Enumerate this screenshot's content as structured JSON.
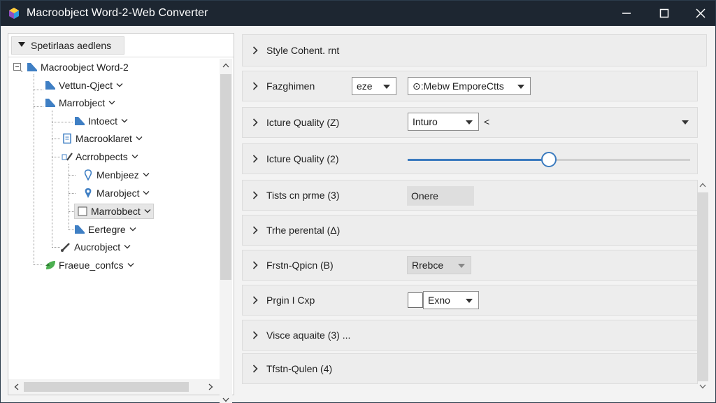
{
  "window": {
    "title": "Macroobject Word-2-Web Converter",
    "controls": [
      "minimize",
      "maximize",
      "close"
    ]
  },
  "tree": {
    "header": "Spetirlaas aedlens",
    "items": [
      {
        "label": "Macroobject Word-2",
        "icon": "folder-icon",
        "expanded": true
      },
      {
        "label": "Vettun-Qject",
        "icon": "folder-icon"
      },
      {
        "label": "Marrobject",
        "icon": "folder-icon"
      },
      {
        "label": "Intoect",
        "icon": "folder-icon"
      },
      {
        "label": "Macrooklaret",
        "icon": "document-icon"
      },
      {
        "label": "Acrrobpects",
        "icon": "brush-icon"
      },
      {
        "label": "Menbjeez",
        "icon": "pin-icon"
      },
      {
        "label": "Marobject",
        "icon": "pin-icon"
      },
      {
        "label": "Marrobbect",
        "icon": "checkbox-icon",
        "selected": true
      },
      {
        "label": "Eertegre",
        "icon": "folder-icon"
      },
      {
        "label": "Aucrobject",
        "icon": "brush-icon"
      },
      {
        "label": "Fraeue_confcs",
        "icon": "leaf-icon"
      }
    ]
  },
  "properties": {
    "rows": [
      {
        "label": "Style Cohent. rnt"
      },
      {
        "label": "Fazghimen",
        "small_dropdown": "eze",
        "dropdown": "⊙:Mebw EmporeCtts"
      },
      {
        "label": "Icture Quality (Z)",
        "dropdown": "Inturo",
        "extra": "<"
      },
      {
        "label": "Icture Quality (2)",
        "slider_value": 0.5
      },
      {
        "label": "Tists cn prme (3)",
        "value": "Onere"
      },
      {
        "label": "Trhe perental (Δ)"
      },
      {
        "label": "Frstn-Qpicn (B)",
        "dropdown": "Rrebce"
      },
      {
        "label": "Prgin I Cxp",
        "dropdown": "Exno"
      },
      {
        "label": "Visce aquaite (3) ..."
      },
      {
        "label": "Tfstn-Qulen (4)"
      }
    ]
  },
  "colors": {
    "titlebar": "#1d2631",
    "accent": "#3b7bbf",
    "folder": "#3f7fc4",
    "leaf": "#4caf50"
  }
}
